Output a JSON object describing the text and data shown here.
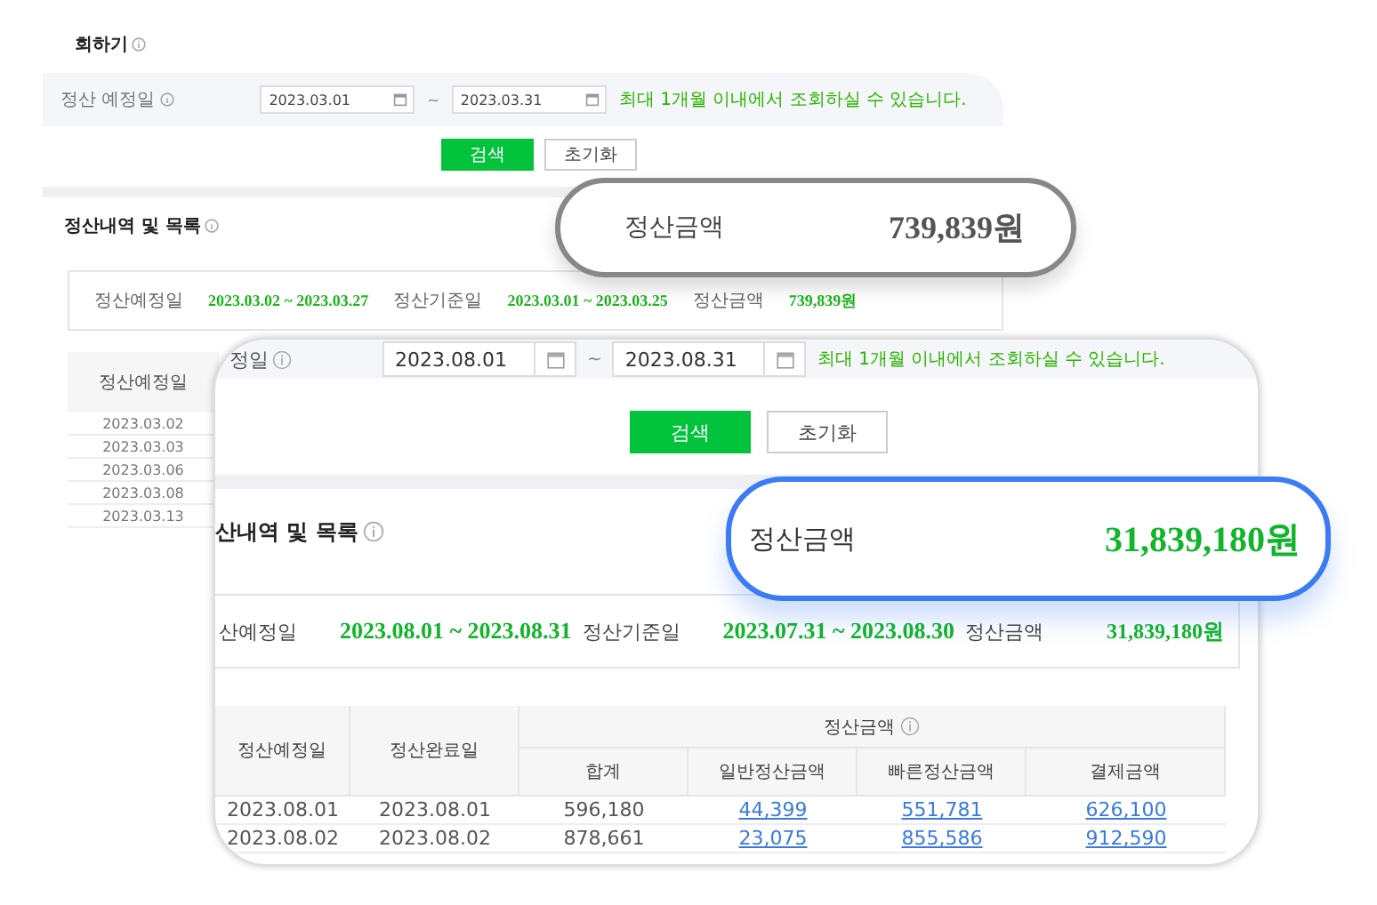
{
  "back_panel": {
    "title": "회하기",
    "filter": {
      "label": "정산 예정일",
      "start": "2023.03.01",
      "separator": "~",
      "end": "2023.03.31",
      "hint": "최대 1개월 이내에서 조회하실 수 있습니다."
    },
    "buttons": [
      {
        "label": "검색",
        "kind": "primary"
      },
      {
        "label": "초기화",
        "kind": "secondary"
      }
    ],
    "section_title": "정산내역 및 목록",
    "summary": [
      {
        "label": "정산예정일",
        "value": "2023.03.02 ~ 2023.03.27"
      },
      {
        "label": "정산기준일",
        "value": "2023.03.01 ~ 2023.03.25"
      },
      {
        "label": "정산금액",
        "value": "739,839원"
      }
    ],
    "table": {
      "columns": [
        "정산예정일"
      ],
      "rows": [
        "2023.03.02",
        "2023.03.03",
        "2023.03.06",
        "2023.03.08",
        "2023.03.13"
      ]
    }
  },
  "front_panel": {
    "filter": {
      "label": "정일",
      "start": "2023.08.01",
      "separator": "~",
      "end": "2023.08.31",
      "hint": "최대 1개월 이내에서 조회하실 수 있습니다."
    },
    "buttons": [
      {
        "label": "검색",
        "kind": "primary"
      },
      {
        "label": "초기화",
        "kind": "secondary"
      }
    ],
    "section_title": "산내역 및 목록",
    "summary": [
      {
        "label": "산예정일",
        "value": "2023.08.01 ~ 2023.08.31"
      },
      {
        "label": "정산기준일",
        "value": "2023.07.31 ~ 2023.08.30"
      },
      {
        "label": "정산금액",
        "value": "31,839,180원"
      }
    ],
    "table": {
      "columns": [
        {
          "label": "정산예정일"
        },
        {
          "label": "정산완료일"
        }
      ],
      "group": {
        "label": "정산금액",
        "columns": [
          {
            "label": "합계",
            "kind": "text"
          },
          {
            "label": "일반정산금액",
            "kind": "link"
          },
          {
            "label": "빠른정산금액",
            "kind": "link"
          },
          {
            "label": "결제금액",
            "kind": "link"
          }
        ]
      },
      "rows": [
        {
          "cells": [
            "2023.08.01",
            "2023.08.01",
            "596,180",
            "44,399",
            "551,781",
            "626,100"
          ]
        },
        {
          "cells": [
            "2023.08.02",
            "2023.08.02",
            "878,661",
            "23,075",
            "855,586",
            "912,590"
          ]
        }
      ]
    }
  },
  "callouts": [
    {
      "label": "정산금액",
      "value": "739,839원",
      "kind": "grey"
    },
    {
      "label": "정산금액",
      "value": "31,839,180원",
      "kind": "blue"
    }
  ]
}
